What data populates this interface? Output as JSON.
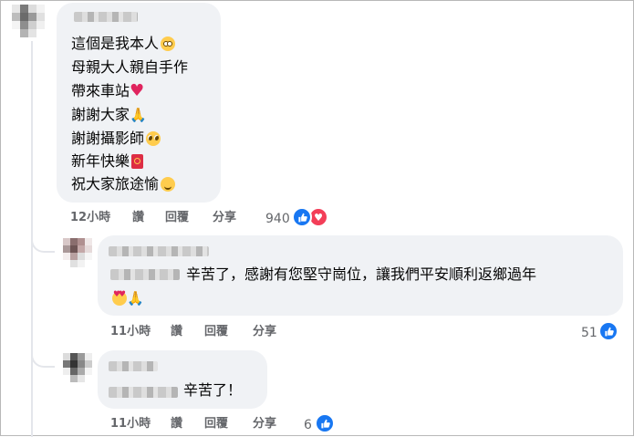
{
  "comments": [
    {
      "lines": [
        "這個是我本人",
        "母親大人親自手作",
        "帶來車站",
        "謝謝大家",
        "謝謝攝影師",
        "新年快樂",
        "祝大家旅途愉"
      ],
      "emojis": [
        "flushed-face",
        "",
        "red-heart",
        "folded-hands",
        "pleading-face",
        "red-envelope",
        "smiling-face"
      ],
      "time": "12小時",
      "like_label": "讚",
      "reply_label": "回覆",
      "share_label": "分享",
      "reaction_count": "940",
      "reactions": [
        "like",
        "love"
      ]
    },
    {
      "text": "辛苦了，感謝有您堅守崗位，讓我們平安順利返鄉過年",
      "emojis": [
        "heart-eyes-face",
        "folded-hands"
      ],
      "time": "11小時",
      "like_label": "讚",
      "reply_label": "回覆",
      "share_label": "分享",
      "reaction_count": "51",
      "reactions": [
        "like"
      ]
    },
    {
      "text": "辛苦了！",
      "time": "11小時",
      "like_label": "讚",
      "reply_label": "回覆",
      "share_label": "分享",
      "reaction_count": "6",
      "reactions": [
        "like"
      ]
    }
  ],
  "colors": {
    "bubble": "#f0f2f5",
    "action_text": "#65676b",
    "like_blue": "#1877f2",
    "love_red": "#f33e58"
  }
}
